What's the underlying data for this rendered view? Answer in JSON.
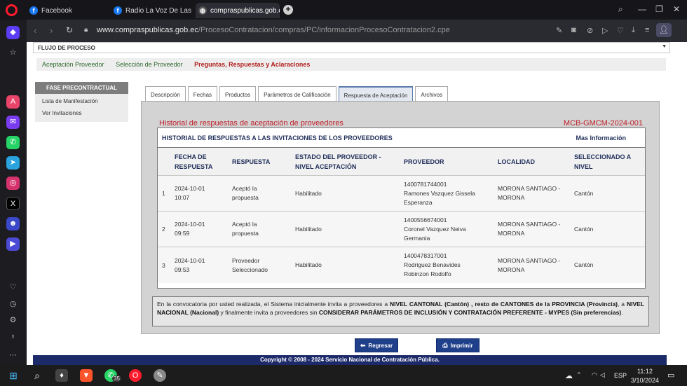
{
  "browser": {
    "tabs": [
      {
        "label": "Facebook",
        "favicon": "f"
      },
      {
        "label": "Radio La Voz De Las Casc",
        "favicon": "f"
      },
      {
        "label": "compraspublicas.gob.ec/P",
        "favicon": "globe"
      }
    ],
    "url_host": "www.compraspublicas.gob.ec",
    "url_path": "/ProcesoContratacion/compras/PC/informacionProcesoContratacion2.cpe",
    "accent": "#ff1b2d"
  },
  "page": {
    "flujo_label": "FLUJO DE PROCESO",
    "breadcrumb": [
      "Aceptación Proveedor",
      "Selección de Proveedor",
      "Preguntas, Respuestas y Aclaraciones"
    ],
    "fase": {
      "title": "FASE PRECONTRACTUAL",
      "items": [
        "Lista de Manifestación",
        "Ver Invitaciones"
      ]
    },
    "tabs": [
      "Descripción",
      "Fechas",
      "Productos",
      "Parámetros de Calificación",
      "Respuesta de Aceptación",
      "Archivos"
    ],
    "historial_title": "Historial de respuestas de aceptación de proveedores",
    "process_code": "MCB-GMCM-2024-001",
    "grid_title": "HISTORIAL DE RESPUESTAS A LAS INVITACIONES DE LOS PROVEEDORES",
    "more_info": "Mas Información",
    "columns": {
      "fecha": [
        "FECHA DE",
        "RESPUESTA"
      ],
      "respuesta": "RESPUESTA",
      "estado": [
        "ESTADO DEL PROVEEDOR -",
        "NIVEL ACEPTACIÓN"
      ],
      "proveedor": "PROVEEDOR",
      "localidad": "LOCALIDAD",
      "seleccionado": [
        "SELECCIONADO A",
        "NIVEL"
      ]
    },
    "rows": [
      {
        "n": "1",
        "fecha": [
          "2024-10-01",
          "10:07"
        ],
        "respuesta": [
          "Aceptó la",
          "propuesta"
        ],
        "estado": "Habilitado",
        "proveedor": [
          "1400781744001",
          "Ramones Vazquez Gissela",
          "Esperanza"
        ],
        "localidad": [
          "MORONA SANTIAGO -",
          "MORONA"
        ],
        "nivel": "Cantón"
      },
      {
        "n": "2",
        "fecha": [
          "2024-10-01",
          "09:59"
        ],
        "respuesta": [
          "Aceptó la",
          "propuesta"
        ],
        "estado": "Habilitado",
        "proveedor": [
          "1400556674001",
          "Coronel Vazquez Neiva",
          "Germania"
        ],
        "localidad": [
          "MORONA SANTIAGO -",
          "MORONA"
        ],
        "nivel": "Cantón"
      },
      {
        "n": "3",
        "fecha": [
          "2024-10-01",
          "09:53"
        ],
        "respuesta": [
          "Proveedor",
          "Seleccionado"
        ],
        "estado": "Habilitado",
        "proveedor": [
          "1400478317001",
          "Rodriguez Benavides",
          "Robinzon Rodolfo"
        ],
        "localidad": [
          "MORONA SANTIAGO -",
          "MORONA"
        ],
        "nivel": "Cantón"
      }
    ],
    "notice": {
      "p1": "En la convocatoria por usted realizada, el Sistema inicialmente invita a proveedores a ",
      "b1": "NIVEL CANTONAL (Cantón) , resto de CANTONES de la PROVINCIA (Provincia)",
      "p2": ", a ",
      "b2": "NIVEL NACIONAL (Nacional)",
      "p3": " y finalmente invita a proveedores sin ",
      "b3": "CONSIDERAR PARÁMETROS DE INCLUSIÓN Y CONTRATACIÓN PREFERENTE - MYPES (Sin preferencias)",
      "p4": "."
    },
    "btn_regresar": "Regresar",
    "btn_imprimir": "Imprimir",
    "footer": "Copyright © 2008 - 2024 Servicio Nacional de Contratación Pública."
  },
  "taskbar": {
    "whatsapp_badge": "35",
    "lang": "ESP",
    "time": "11:12",
    "date": "3/10/2024"
  }
}
